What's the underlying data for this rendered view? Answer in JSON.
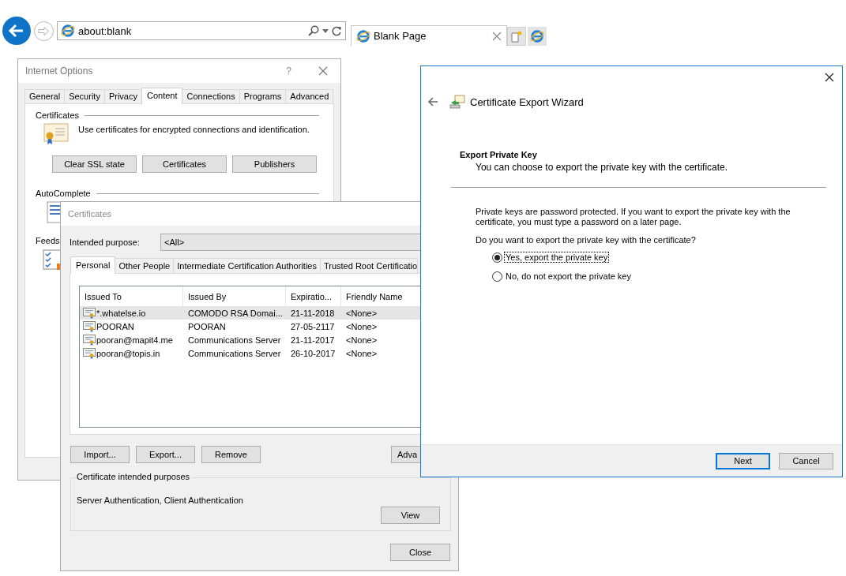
{
  "browser": {
    "address": "about:blank",
    "tabs": [
      {
        "title": "Blank Page",
        "selected": true
      }
    ]
  },
  "internet_options": {
    "title": "Internet Options",
    "help": "?",
    "tabs": [
      {
        "label": "General",
        "selected": false
      },
      {
        "label": "Security",
        "selected": false
      },
      {
        "label": "Privacy",
        "selected": false
      },
      {
        "label": "Content",
        "selected": true
      },
      {
        "label": "Connections",
        "selected": false
      },
      {
        "label": "Programs",
        "selected": false
      },
      {
        "label": "Advanced",
        "selected": false
      }
    ],
    "certificates_group": {
      "title": "Certificates",
      "description": "Use certificates for encrypted connections and identification.",
      "buttons": [
        "Clear SSL state",
        "Certificates",
        "Publishers"
      ]
    },
    "autocomplete_group": {
      "title": "AutoComplete"
    },
    "feeds_label": "Feeds"
  },
  "certificates": {
    "title": "Certificates",
    "purpose_label": "Intended purpose:",
    "purpose_value": "<All>",
    "tabs": [
      {
        "label": "Personal",
        "selected": true
      },
      {
        "label": "Other People",
        "selected": false
      },
      {
        "label": "Intermediate Certification Authorities",
        "selected": false
      },
      {
        "label": "Trusted Root Certificatio",
        "selected": false
      }
    ],
    "columns": [
      "Issued To",
      "Issued By",
      "Expiratio...",
      "Friendly Name"
    ],
    "rows": [
      {
        "cells": [
          "*.whatelse.io",
          "COMODO RSA Domai...",
          "21-11-2018",
          "<None>"
        ],
        "selected": true
      },
      {
        "cells": [
          "POORAN",
          "POORAN",
          "27-05-2117",
          "<None>"
        ],
        "selected": false
      },
      {
        "cells": [
          "pooran@mapit4.me",
          "Communications Server",
          "21-11-2017",
          "<None>"
        ],
        "selected": false
      },
      {
        "cells": [
          "pooran@topis.in",
          "Communications Server",
          "26-10-2017",
          "<None>"
        ],
        "selected": false
      }
    ],
    "buttons": [
      "Import...",
      "Export...",
      "Remove"
    ],
    "advanced_button": "Adva",
    "purposes_group": {
      "title": "Certificate intended purposes",
      "text": "Server Authentication, Client Authentication",
      "button": "View"
    },
    "close": "Close"
  },
  "wizard": {
    "title": "Certificate Export Wizard",
    "heading": "Export Private Key",
    "subheading": "You can choose to export the private key with the certificate.",
    "body": "Private keys are password protected. If you want to export the private key with the certificate, you must type a password on a later page.",
    "question": "Do you want to export the private key with the certificate?",
    "options": [
      {
        "label": "Yes, export the private key",
        "selected": true
      },
      {
        "label": "No, do not export the private key",
        "selected": false
      }
    ],
    "buttons": [
      {
        "label": "Next",
        "default": true
      },
      {
        "label": "Cancel",
        "default": false
      }
    ]
  }
}
